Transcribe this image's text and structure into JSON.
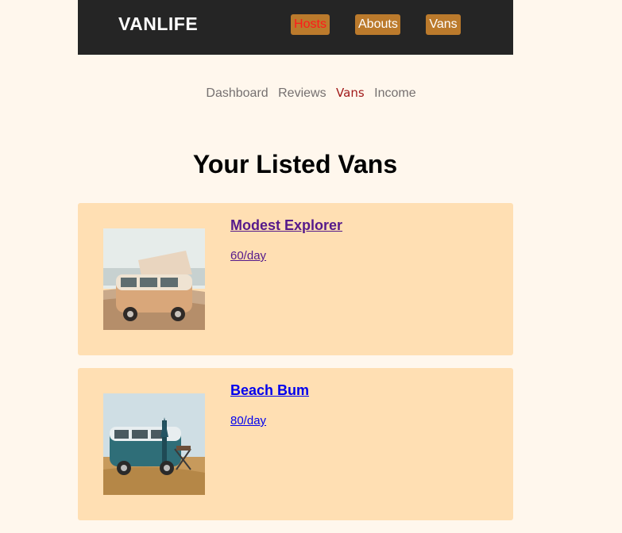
{
  "header": {
    "logo": "VANLIFE",
    "nav": [
      {
        "label": "Hosts"
      },
      {
        "label": "Abouts"
      },
      {
        "label": "Vans"
      }
    ]
  },
  "subnav": [
    {
      "label": "Dashboard"
    },
    {
      "label": "Reviews"
    },
    {
      "label": "Vans",
      "active": true
    },
    {
      "label": "Income"
    }
  ],
  "page_title": "Your Listed Vans",
  "vans": [
    {
      "name": "Modest Explorer",
      "price": "60/day"
    },
    {
      "name": "Beach Bum",
      "price": "80/day"
    }
  ],
  "colors": {
    "page_bg": "#fff7ed",
    "topbar_bg": "#252525",
    "nav_button_bg": "#bb7a2c",
    "active_nav_text": "#ff1a1a",
    "card_bg": "#ffdfb3",
    "subnav_active": "#a11a1a"
  }
}
